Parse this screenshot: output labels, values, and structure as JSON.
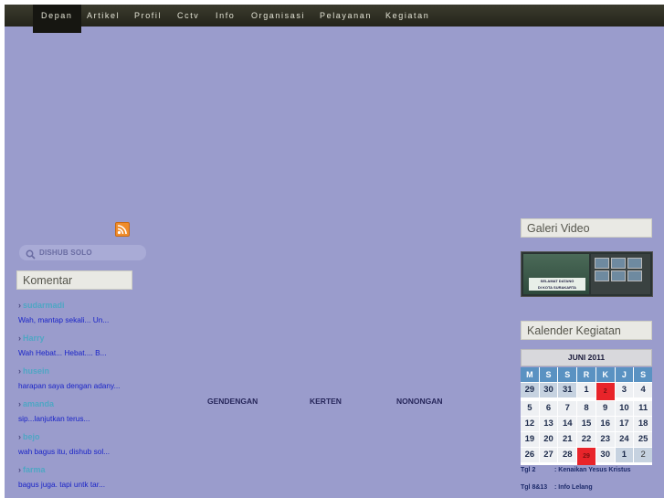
{
  "nav": {
    "items": [
      "Depan",
      "Artikel",
      "Profil",
      "Cctv",
      "Info",
      "Organisasi",
      "Pelayanan",
      "Kegiatan"
    ],
    "active": "Depan"
  },
  "sidebar": {
    "rss_icon": "rss-icon",
    "search": {
      "placeholder": "DISHUB SOLO",
      "icon": "search-icon"
    },
    "comments_title": "Komentar",
    "comments": [
      {
        "author": "sudarmadi",
        "text": "Wah, mantap sekali... Un..."
      },
      {
        "author": "Harry",
        "text": "Wah Hebat... Hebat.... B..."
      },
      {
        "author": "husein",
        "text": "harapan saya dengan adany..."
      },
      {
        "author": "amanda",
        "text": "sip...lanjutkan terus..."
      },
      {
        "author": "bejo",
        "text": "wah bagus itu, dishub sol..."
      },
      {
        "author": "farma",
        "text": "bagus juga. tapi untk tar..."
      }
    ]
  },
  "main": {
    "links": [
      "GENDENGAN",
      "KERTEN",
      "NONONGAN"
    ]
  },
  "right": {
    "video_title": "Galeri Video",
    "video_sign": [
      "SELAMAT DATANG",
      "DI KOTA SURAKARTA"
    ],
    "calendar_title": "Kalender Kegiatan",
    "calendar": {
      "month": "JUNI 2011",
      "headers": [
        "M",
        "S",
        "S",
        "R",
        "K",
        "J",
        "S"
      ],
      "rows": [
        [
          "29",
          "30",
          "31",
          "1",
          "2",
          "3",
          "4"
        ],
        [
          "5",
          "6",
          "7",
          "8",
          "9",
          "10",
          "11"
        ],
        [
          "12",
          "13",
          "14",
          "15",
          "16",
          "17",
          "18"
        ],
        [
          "19",
          "20",
          "21",
          "22",
          "23",
          "24",
          "25"
        ],
        [
          "26",
          "27",
          "28",
          "29",
          "30",
          "1",
          "2"
        ]
      ],
      "event_color": "#e8242a",
      "header_color": "#5a92c2"
    },
    "events": [
      {
        "date": "Tgl 2",
        "label": ": Kenaikan Yesus Kristus"
      },
      {
        "date": "Tgl 8&13",
        "label": ": Info Lelang"
      }
    ]
  },
  "colors": {
    "background": "#9a9ccc",
    "navbar": "#2e2e22",
    "comment_author": "#4fa6c4",
    "comment_text": "#1a24c8"
  }
}
